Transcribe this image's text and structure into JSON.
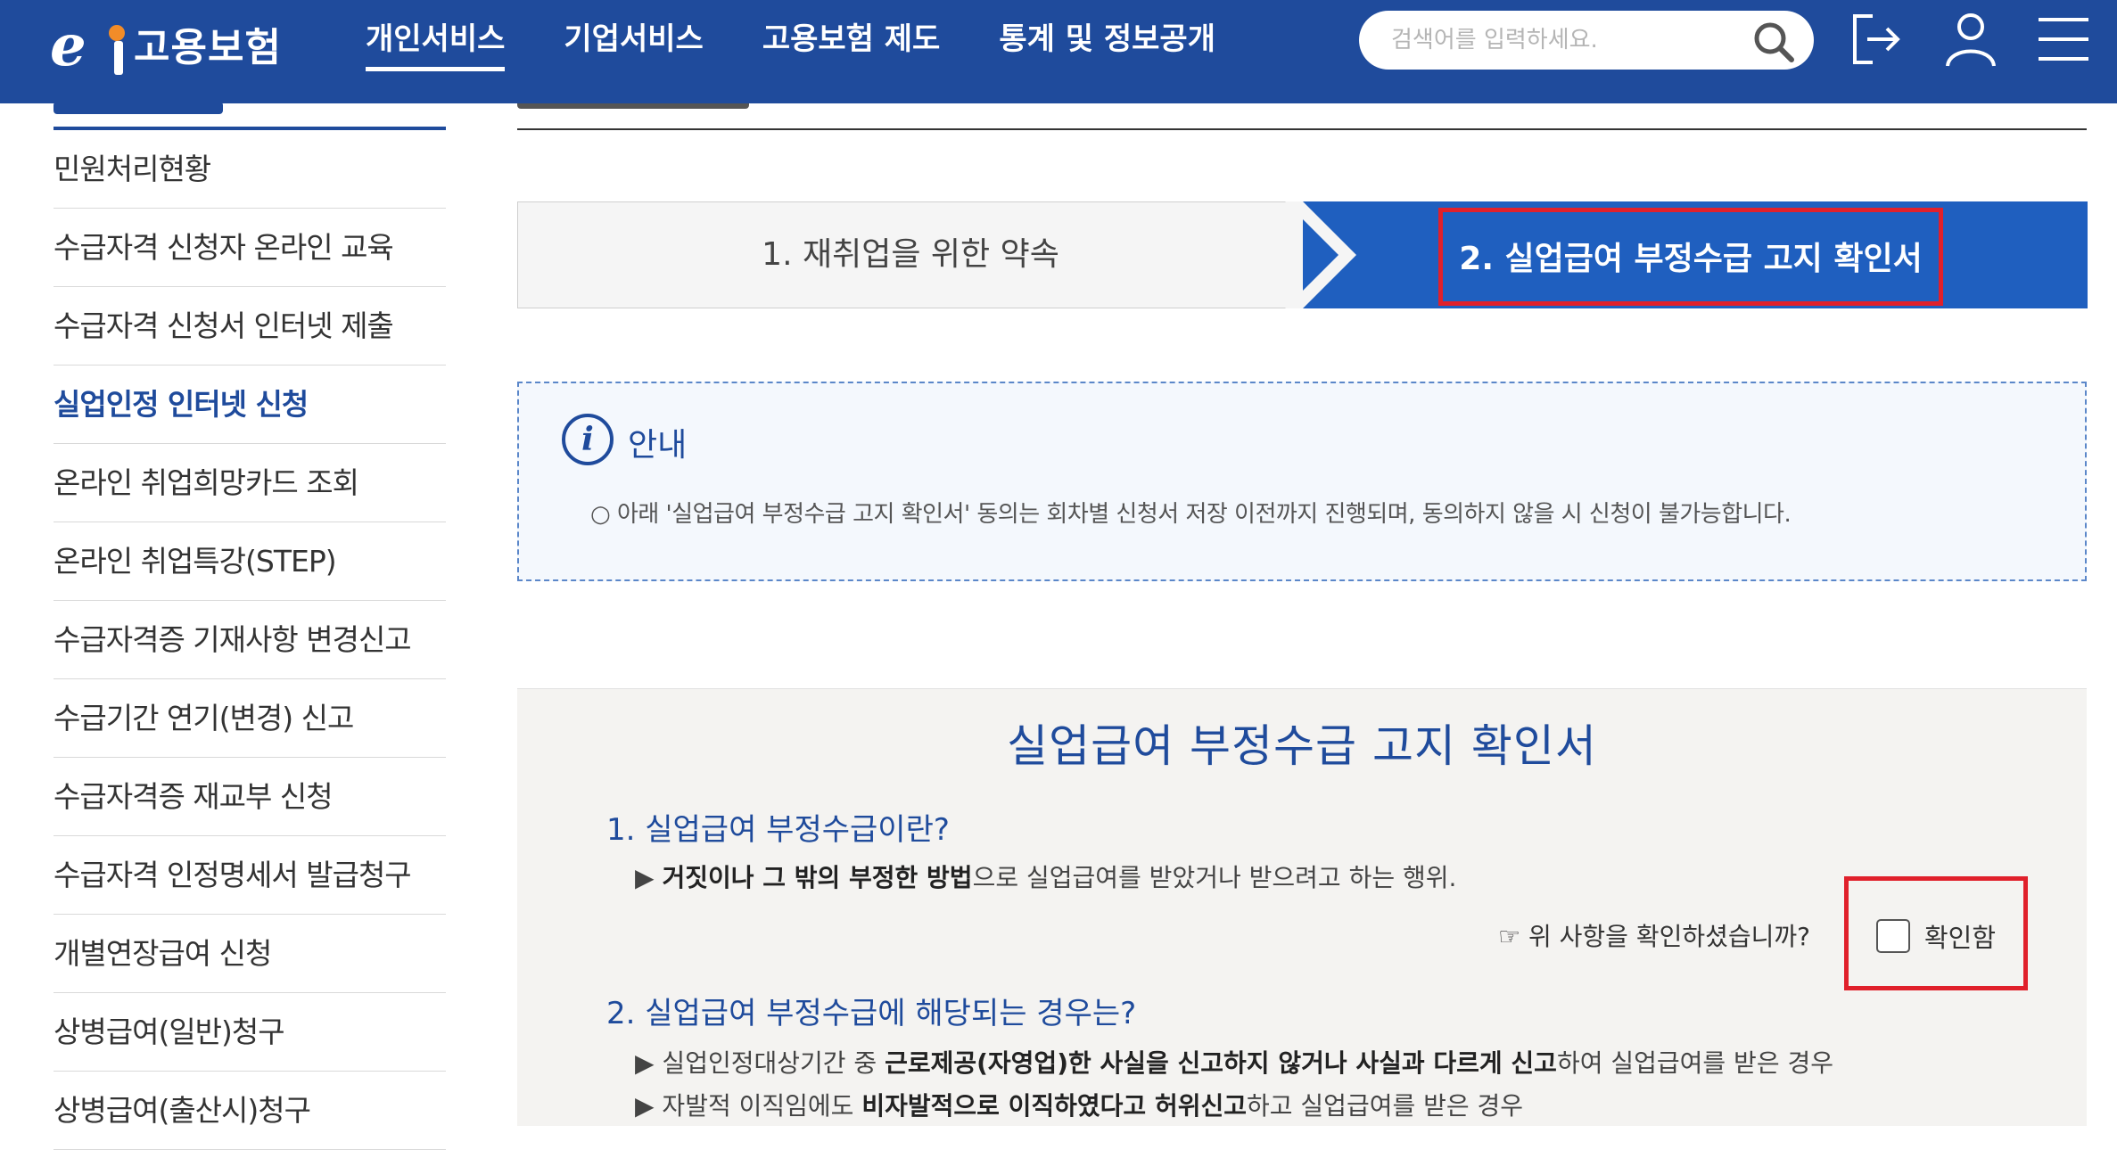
{
  "header": {
    "logo_text": "고용보험",
    "nav": [
      "개인서비스",
      "기업서비스",
      "고용보험 제도",
      "통계 및 정보공개"
    ],
    "search_placeholder": "검색어를 입력하세요."
  },
  "sidebar": {
    "items": [
      "민원처리현황",
      "수급자격 신청자 온라인 교육",
      "수급자격 신청서 인터넷 제출",
      "실업인정 인터넷 신청",
      "온라인 취업희망카드 조회",
      "온라인 취업특강(STEP)",
      "수급자격증 기재사항 변경신고",
      "수급기간 연기(변경) 신고",
      "수급자격증 재교부 신청",
      "수급자격 인정명세서 발급청구",
      "개별연장급여 신청",
      "상병급여(일반)청구",
      "상병급여(출산시)청구"
    ],
    "active_index": 3
  },
  "steps": {
    "step1": "1. 재취업을 위한 약속",
    "step2": "2. 실업급여 부정수급 고지 확인서"
  },
  "notice": {
    "title": "안내",
    "text": "○ 아래 '실업급여 부정수급 고지 확인서' 동의는 회차별 신청서 저장 이전까지 진행되며, 동의하지 않을 시 신청이 불가능합니다."
  },
  "form": {
    "title": "실업급여 부정수급 고지 확인서",
    "q1": "1. 실업급여 부정수급이란?",
    "q1_bullet_prefix": "▶ ",
    "q1_bullet_bold": "거짓이나 그 밖의 부정한 방법",
    "q1_bullet_rest": "으로 실업급여를 받았거나 받으려고 하는 행위.",
    "confirm_question": "☞ 위 사항을 확인하셨습니까?",
    "confirm_label": "확인함",
    "confirm_checked": false,
    "q2": "2. 실업급여 부정수급에 해당되는 경우는?",
    "q2_b1_pre": "▶ 실업인정대상기간 중 ",
    "q2_b1_bold": "근로제공(자영업)한 사실을 신고하지 않거나 사실과 다르게 신고",
    "q2_b1_post": "하여 실업급여를 받은 경우",
    "q2_b2_pre": "▶ 자발적 이직임에도 ",
    "q2_b2_bold": "비자발적으로 이직하였다고 허위신고",
    "q2_b2_post": "하고 실업급여를 받은 경우"
  }
}
